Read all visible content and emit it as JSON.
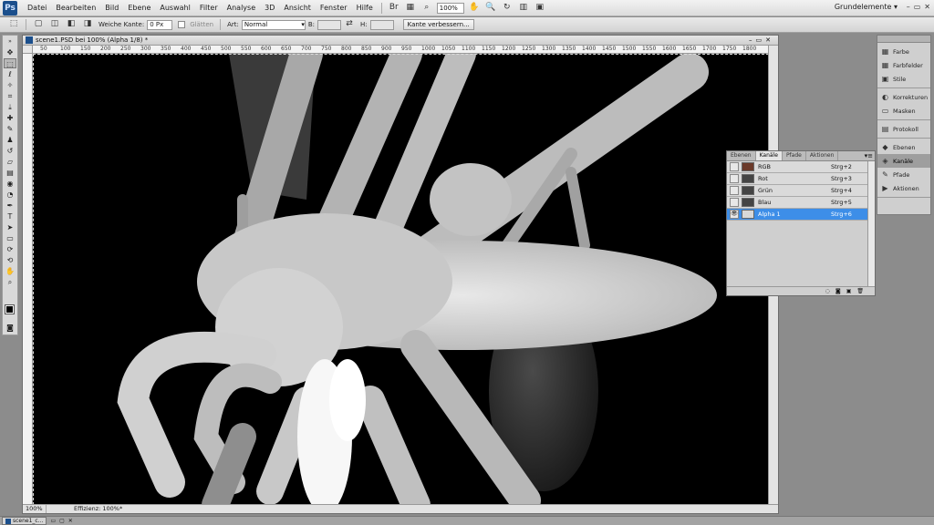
{
  "app": {
    "logo": "Ps"
  },
  "menubar": {
    "items": [
      "Datei",
      "Bearbeiten",
      "Bild",
      "Ebene",
      "Auswahl",
      "Filter",
      "Analyse",
      "3D",
      "Ansicht",
      "Fenster",
      "Hilfe"
    ],
    "zoom": "100%",
    "workspace": "Grundelemente ▾",
    "window_controls": [
      "–",
      "▭",
      "✕"
    ]
  },
  "options": {
    "feather_label": "Weiche Kante:",
    "feather_value": "0 Px",
    "antialias_label": "Glätten",
    "style_label": "Art:",
    "style_value": "Normal",
    "refine_edge": "Kante verbessern..."
  },
  "document": {
    "title": "scene1.PSD bei 100% (Alpha 1/8) *",
    "controls": "–▭✕",
    "zoom": "100%",
    "status": "Effizienz: 100%*",
    "ruler_ticks": [
      "50",
      "100",
      "150",
      "200",
      "250",
      "300",
      "350",
      "400",
      "450",
      "500",
      "550",
      "600",
      "650",
      "700",
      "750",
      "800",
      "850",
      "900",
      "950",
      "1000",
      "1050",
      "1100",
      "1150",
      "1200",
      "1250",
      "1300",
      "1350",
      "1400",
      "1450",
      "1500",
      "1550",
      "1600",
      "1650",
      "1700",
      "1750",
      "1800"
    ]
  },
  "channels_panel": {
    "tabs": [
      "Ebenen",
      "Kanäle",
      "Pfade",
      "Aktionen"
    ],
    "active_tab": 1,
    "menu": "▾≡",
    "rows": [
      {
        "name": "RGB",
        "key": "Strg+2",
        "visible": false
      },
      {
        "name": "Rot",
        "key": "Strg+3",
        "visible": false
      },
      {
        "name": "Grün",
        "key": "Strg+4",
        "visible": false
      },
      {
        "name": "Blau",
        "key": "Strg+5",
        "visible": false
      },
      {
        "name": "Alpha 1",
        "key": "Strg+6",
        "visible": true
      }
    ],
    "selected_row": 4,
    "footer_icons": [
      "◌",
      "◙",
      "▣",
      "🗑"
    ]
  },
  "dock": {
    "groups": [
      [
        {
          "label": "Farbe",
          "icon": "▦"
        },
        {
          "label": "Farbfelder",
          "icon": "▦"
        },
        {
          "label": "Stile",
          "icon": "▣"
        }
      ],
      [
        {
          "label": "Korrekturen",
          "icon": "◐"
        },
        {
          "label": "Masken",
          "icon": "▭"
        }
      ],
      [
        {
          "label": "Protokoll",
          "icon": "▤"
        }
      ],
      [
        {
          "label": "Ebenen",
          "icon": "◆"
        },
        {
          "label": "Kanäle",
          "icon": "◈"
        },
        {
          "label": "Pfade",
          "icon": "✎"
        },
        {
          "label": "Aktionen",
          "icon": "▶"
        }
      ]
    ],
    "active": "Kanäle"
  },
  "taskbar": {
    "item": "scene1_c...",
    "controls": [
      "▭",
      "▢",
      "✕"
    ]
  }
}
